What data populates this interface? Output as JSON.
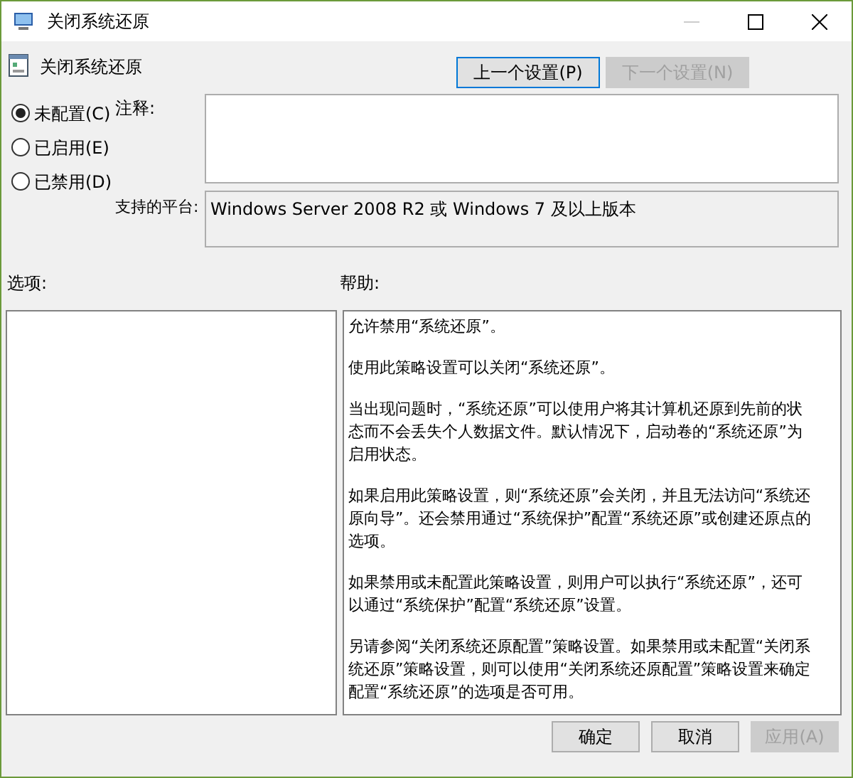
{
  "window": {
    "title": "关闭系统还原"
  },
  "policy_title": "关闭系统还原",
  "nav_buttons": [
    {
      "label": "上一个设置(P)",
      "disabled": false
    },
    {
      "label": "下一个设置(N)",
      "disabled": true
    }
  ],
  "options": [
    {
      "label": "未配置(C)",
      "selected": true
    },
    {
      "label": "已启用(E)",
      "selected": false
    },
    {
      "label": "已禁用(D)",
      "selected": false
    }
  ],
  "comment": {
    "label": "注释:"
  },
  "platform": {
    "label": "支持的平台:",
    "value": "Windows Server 2008 R2 或 Windows 7 及以上版本"
  },
  "options_label": "选项:",
  "help_label": "帮助:",
  "help": [
    "允许禁用“系统还原”。",
    "使用此策略设置可以关闭“系统还原”。",
    "当出现问题时，“系统还原”可以使用户将其计算机还原到先前的状态而不会丢失个人数据文件。默认情况下，启动卷的“系统还原”为启用状态。",
    "如果启用此策略设置，则“系统还原”会关闭，并且无法访问“系统还原向导”。还会禁用通过“系统保护”配置“系统还原”或创建还原点的选项。",
    "如果禁用或未配置此策略设置，则用户可以执行“系统还原”，还可以通过“系统保护”配置“系统还原”设置。",
    "另请参阅“关闭系统还原配置”策略设置。如果禁用或未配置“关闭系统还原”策略设置，则可以使用“关闭系统还原配置”策略设置来确定配置“系统还原”的选项是否可用。"
  ],
  "buttons": [
    {
      "label": "确定",
      "disabled": false
    },
    {
      "label": "取消",
      "disabled": false
    },
    {
      "label": "应用(A)",
      "disabled": true
    }
  ]
}
